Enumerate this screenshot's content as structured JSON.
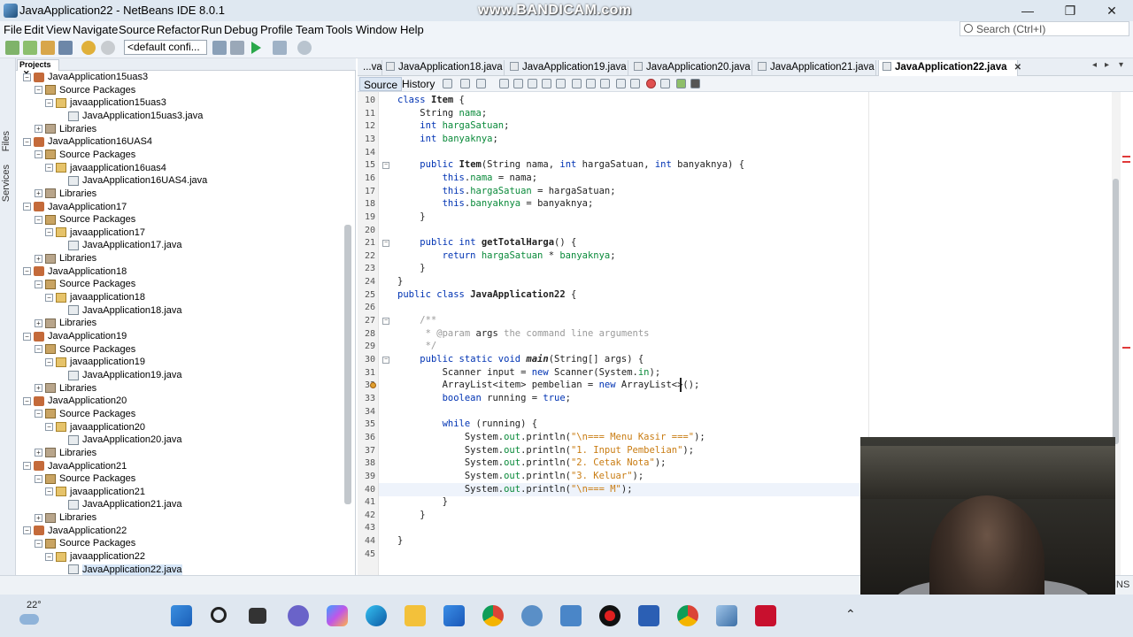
{
  "window": {
    "title": "JavaApplication22 - NetBeans IDE 8.0.1",
    "watermark": "www.BANDICAM.com",
    "minimize": "—",
    "maximize": "❐",
    "close": "✕"
  },
  "menu": [
    "File",
    "Edit",
    "View",
    "Navigate",
    "Source",
    "Refactor",
    "Run",
    "Debug",
    "Profile",
    "Team",
    "Tools",
    "Window",
    "Help"
  ],
  "search": {
    "placeholder": "Search (Ctrl+I)"
  },
  "toolbar": {
    "config": "<default confi..."
  },
  "side_tabs": {
    "files": "Files",
    "services": "Services"
  },
  "projects_tab": "Projects",
  "tree": [
    {
      "label": "JavaApplication15uas3",
      "type": "project",
      "level": 0,
      "exp": "−"
    },
    {
      "label": "Source Packages",
      "type": "pkgs",
      "level": 1,
      "exp": "−"
    },
    {
      "label": "javaapplication15uas3",
      "type": "pkg",
      "level": 2,
      "exp": "−"
    },
    {
      "label": "JavaApplication15uas3.java",
      "type": "file",
      "level": 3,
      "exp": ""
    },
    {
      "label": "Libraries",
      "type": "lib",
      "level": 1,
      "exp": "+"
    },
    {
      "label": "JavaApplication16UAS4",
      "type": "project",
      "level": 0,
      "exp": "−"
    },
    {
      "label": "Source Packages",
      "type": "pkgs",
      "level": 1,
      "exp": "−"
    },
    {
      "label": "javaapplication16uas4",
      "type": "pkg",
      "level": 2,
      "exp": "−"
    },
    {
      "label": "JavaApplication16UAS4.java",
      "type": "file",
      "level": 3,
      "exp": ""
    },
    {
      "label": "Libraries",
      "type": "lib",
      "level": 1,
      "exp": "+"
    },
    {
      "label": "JavaApplication17",
      "type": "project",
      "level": 0,
      "exp": "−"
    },
    {
      "label": "Source Packages",
      "type": "pkgs",
      "level": 1,
      "exp": "−"
    },
    {
      "label": "javaapplication17",
      "type": "pkg",
      "level": 2,
      "exp": "−"
    },
    {
      "label": "JavaApplication17.java",
      "type": "file",
      "level": 3,
      "exp": ""
    },
    {
      "label": "Libraries",
      "type": "lib",
      "level": 1,
      "exp": "+"
    },
    {
      "label": "JavaApplication18",
      "type": "project",
      "level": 0,
      "exp": "−"
    },
    {
      "label": "Source Packages",
      "type": "pkgs",
      "level": 1,
      "exp": "−"
    },
    {
      "label": "javaapplication18",
      "type": "pkg",
      "level": 2,
      "exp": "−"
    },
    {
      "label": "JavaApplication18.java",
      "type": "file",
      "level": 3,
      "exp": ""
    },
    {
      "label": "Libraries",
      "type": "lib",
      "level": 1,
      "exp": "+"
    },
    {
      "label": "JavaApplication19",
      "type": "project",
      "level": 0,
      "exp": "−"
    },
    {
      "label": "Source Packages",
      "type": "pkgs",
      "level": 1,
      "exp": "−"
    },
    {
      "label": "javaapplication19",
      "type": "pkg",
      "level": 2,
      "exp": "−"
    },
    {
      "label": "JavaApplication19.java",
      "type": "file",
      "level": 3,
      "exp": ""
    },
    {
      "label": "Libraries",
      "type": "lib",
      "level": 1,
      "exp": "+"
    },
    {
      "label": "JavaApplication20",
      "type": "project",
      "level": 0,
      "exp": "−"
    },
    {
      "label": "Source Packages",
      "type": "pkgs",
      "level": 1,
      "exp": "−"
    },
    {
      "label": "javaapplication20",
      "type": "pkg",
      "level": 2,
      "exp": "−"
    },
    {
      "label": "JavaApplication20.java",
      "type": "file",
      "level": 3,
      "exp": ""
    },
    {
      "label": "Libraries",
      "type": "lib",
      "level": 1,
      "exp": "+"
    },
    {
      "label": "JavaApplication21",
      "type": "project",
      "level": 0,
      "exp": "−"
    },
    {
      "label": "Source Packages",
      "type": "pkgs",
      "level": 1,
      "exp": "−"
    },
    {
      "label": "javaapplication21",
      "type": "pkg",
      "level": 2,
      "exp": "−"
    },
    {
      "label": "JavaApplication21.java",
      "type": "file",
      "level": 3,
      "exp": ""
    },
    {
      "label": "Libraries",
      "type": "lib",
      "level": 1,
      "exp": "+"
    },
    {
      "label": "JavaApplication22",
      "type": "project",
      "level": 0,
      "exp": "−"
    },
    {
      "label": "Source Packages",
      "type": "pkgs",
      "level": 1,
      "exp": "−"
    },
    {
      "label": "javaapplication22",
      "type": "pkg",
      "level": 2,
      "exp": "−"
    },
    {
      "label": "JavaApplication22.java",
      "type": "file",
      "level": 3,
      "exp": "",
      "selected": true
    }
  ],
  "editor_tabs": [
    {
      "label": "...va",
      "active": false
    },
    {
      "label": "JavaApplication18.java",
      "active": false
    },
    {
      "label": "JavaApplication19.java",
      "active": false
    },
    {
      "label": "JavaApplication20.java",
      "active": false
    },
    {
      "label": "JavaApplication21.java",
      "active": false
    },
    {
      "label": "JavaApplication22.java",
      "active": true
    }
  ],
  "editor_toolbar": {
    "source": "Source",
    "history": "History"
  },
  "code_lines": [
    {
      "n": "10",
      "fold": "",
      "tokens": [
        [
          "kw",
          "class "
        ],
        [
          "bold",
          "Item "
        ],
        [
          "",
          "{"
        ]
      ]
    },
    {
      "n": "11",
      "fold": "",
      "tokens": [
        [
          "",
          "    String "
        ],
        [
          "fld",
          "nama"
        ],
        [
          "",
          ";"
        ]
      ]
    },
    {
      "n": "12",
      "fold": "",
      "tokens": [
        [
          "",
          "    "
        ],
        [
          "kw",
          "int "
        ],
        [
          "fld",
          "hargaSatuan"
        ],
        [
          "",
          ";"
        ]
      ]
    },
    {
      "n": "13",
      "fold": "",
      "tokens": [
        [
          "",
          "    "
        ],
        [
          "kw",
          "int "
        ],
        [
          "fld",
          "banyaknya"
        ],
        [
          "",
          ";"
        ]
      ]
    },
    {
      "n": "14",
      "fold": "",
      "tokens": [
        [
          "",
          ""
        ]
      ]
    },
    {
      "n": "15",
      "fold": "−",
      "tokens": [
        [
          "",
          "    "
        ],
        [
          "kw",
          "public "
        ],
        [
          "bold",
          "Item"
        ],
        [
          "",
          "(String nama, "
        ],
        [
          "kw",
          "int "
        ],
        [
          "",
          "hargaSatuan, "
        ],
        [
          "kw",
          "int "
        ],
        [
          "",
          "banyaknya) {"
        ]
      ]
    },
    {
      "n": "16",
      "fold": "",
      "tokens": [
        [
          "",
          "        "
        ],
        [
          "kw",
          "this"
        ],
        [
          "",
          "."
        ],
        [
          "fld",
          "nama"
        ],
        [
          "",
          " = nama;"
        ]
      ]
    },
    {
      "n": "17",
      "fold": "",
      "tokens": [
        [
          "",
          "        "
        ],
        [
          "kw",
          "this"
        ],
        [
          "",
          "."
        ],
        [
          "fld",
          "hargaSatuan"
        ],
        [
          "",
          " = hargaSatuan;"
        ]
      ]
    },
    {
      "n": "18",
      "fold": "",
      "tokens": [
        [
          "",
          "        "
        ],
        [
          "kw",
          "this"
        ],
        [
          "",
          "."
        ],
        [
          "fld",
          "banyaknya"
        ],
        [
          "",
          " = banyaknya;"
        ]
      ]
    },
    {
      "n": "19",
      "fold": "",
      "tokens": [
        [
          "",
          "    }"
        ]
      ]
    },
    {
      "n": "20",
      "fold": "",
      "tokens": [
        [
          "",
          ""
        ]
      ]
    },
    {
      "n": "21",
      "fold": "−",
      "tokens": [
        [
          "",
          "    "
        ],
        [
          "kw",
          "public int "
        ],
        [
          "bold",
          "getTotalHarga"
        ],
        [
          "",
          "() {"
        ]
      ]
    },
    {
      "n": "22",
      "fold": "",
      "tokens": [
        [
          "",
          "        "
        ],
        [
          "kw",
          "return "
        ],
        [
          "fld",
          "hargaSatuan"
        ],
        [
          "",
          " * "
        ],
        [
          "fld",
          "banyaknya"
        ],
        [
          "",
          ";"
        ]
      ]
    },
    {
      "n": "23",
      "fold": "",
      "tokens": [
        [
          "",
          "    }"
        ]
      ]
    },
    {
      "n": "24",
      "fold": "",
      "tokens": [
        [
          "",
          "}"
        ]
      ]
    },
    {
      "n": "25",
      "fold": "",
      "tokens": [
        [
          "kw",
          "public class "
        ],
        [
          "bold",
          "JavaApplication22 "
        ],
        [
          "",
          "{"
        ]
      ]
    },
    {
      "n": "26",
      "fold": "",
      "tokens": [
        [
          "",
          ""
        ]
      ]
    },
    {
      "n": "27",
      "fold": "−",
      "tokens": [
        [
          "cmt",
          "    /**"
        ]
      ]
    },
    {
      "n": "28",
      "fold": "",
      "tokens": [
        [
          "cmt",
          "     * @param "
        ],
        [
          "",
          "args"
        ],
        [
          "cmt",
          " the command line arguments"
        ]
      ]
    },
    {
      "n": "29",
      "fold": "",
      "tokens": [
        [
          "cmt",
          "     */"
        ]
      ]
    },
    {
      "n": "30",
      "fold": "−",
      "tokens": [
        [
          "",
          "    "
        ],
        [
          "kw",
          "public static void "
        ],
        [
          "ital",
          "main"
        ],
        [
          "",
          "(String[] args) {"
        ]
      ]
    },
    {
      "n": "31",
      "fold": "",
      "tokens": [
        [
          "",
          "        Scanner input = "
        ],
        [
          "kw",
          "new "
        ],
        [
          "",
          "Scanner(System."
        ],
        [
          "fld",
          "in"
        ],
        [
          "",
          ");"
        ]
      ]
    },
    {
      "n": "32",
      "fold": "",
      "tokens": [
        [
          "",
          "        ArrayList<item> pembelian = "
        ],
        [
          "kw",
          "new "
        ],
        [
          "",
          "ArrayList<>();"
        ]
      ]
    },
    {
      "n": "33",
      "fold": "",
      "tokens": [
        [
          "",
          "        "
        ],
        [
          "kw",
          "boolean "
        ],
        [
          "",
          "running = "
        ],
        [
          "kw",
          "true"
        ],
        [
          "",
          ";"
        ]
      ]
    },
    {
      "n": "34",
      "fold": "",
      "tokens": [
        [
          "",
          ""
        ]
      ]
    },
    {
      "n": "35",
      "fold": "",
      "tokens": [
        [
          "",
          "        "
        ],
        [
          "kw",
          "while "
        ],
        [
          "",
          "(running) {"
        ]
      ]
    },
    {
      "n": "36",
      "fold": "",
      "tokens": [
        [
          "",
          "            System."
        ],
        [
          "fld",
          "out"
        ],
        [
          "",
          ".println("
        ],
        [
          "str",
          "\"\\n=== Menu Kasir ===\""
        ],
        [
          "",
          ");"
        ]
      ]
    },
    {
      "n": "37",
      "fold": "",
      "tokens": [
        [
          "",
          "            System."
        ],
        [
          "fld",
          "out"
        ],
        [
          "",
          ".println("
        ],
        [
          "str",
          "\"1. Input Pembelian\""
        ],
        [
          "",
          ");"
        ]
      ]
    },
    {
      "n": "38",
      "fold": "",
      "tokens": [
        [
          "",
          "            System."
        ],
        [
          "fld",
          "out"
        ],
        [
          "",
          ".println("
        ],
        [
          "str",
          "\"2. Cetak Nota\""
        ],
        [
          "",
          ");"
        ]
      ]
    },
    {
      "n": "39",
      "fold": "",
      "tokens": [
        [
          "",
          "            System."
        ],
        [
          "fld",
          "out"
        ],
        [
          "",
          ".println("
        ],
        [
          "str",
          "\"3. Keluar\""
        ],
        [
          "",
          ");"
        ]
      ]
    },
    {
      "n": "40",
      "fold": "",
      "tokens": [
        [
          "",
          "            System."
        ],
        [
          "fld",
          "out"
        ],
        [
          "",
          ".println("
        ],
        [
          "str",
          "\"\\n=== M\""
        ],
        [
          "",
          ");"
        ]
      ]
    },
    {
      "n": "41",
      "fold": "",
      "tokens": [
        [
          "",
          "        }"
        ]
      ]
    },
    {
      "n": "42",
      "fold": "",
      "tokens": [
        [
          "",
          "    }"
        ]
      ]
    },
    {
      "n": "43",
      "fold": "",
      "tokens": [
        [
          "",
          ""
        ]
      ]
    },
    {
      "n": "44",
      "fold": "",
      "tokens": [
        [
          "",
          "}"
        ]
      ]
    },
    {
      "n": "45",
      "fold": "",
      "tokens": [
        [
          "",
          ""
        ]
      ]
    }
  ],
  "status": {
    "ins": "INS"
  },
  "weather": {
    "temp": "22°"
  },
  "taskbar_icons": [
    "windows-start",
    "search",
    "task-view",
    "teams",
    "copilot",
    "edge",
    "file-explorer",
    "store",
    "chrome",
    "settings-globe",
    "notepad",
    "record",
    "word",
    "chrome-profile",
    "virtualbox",
    "acrobat"
  ],
  "colors": {
    "accent": "#0033b3",
    "field": "#0a8a3a",
    "string": "#c97c12",
    "error": "#e03a3a"
  }
}
